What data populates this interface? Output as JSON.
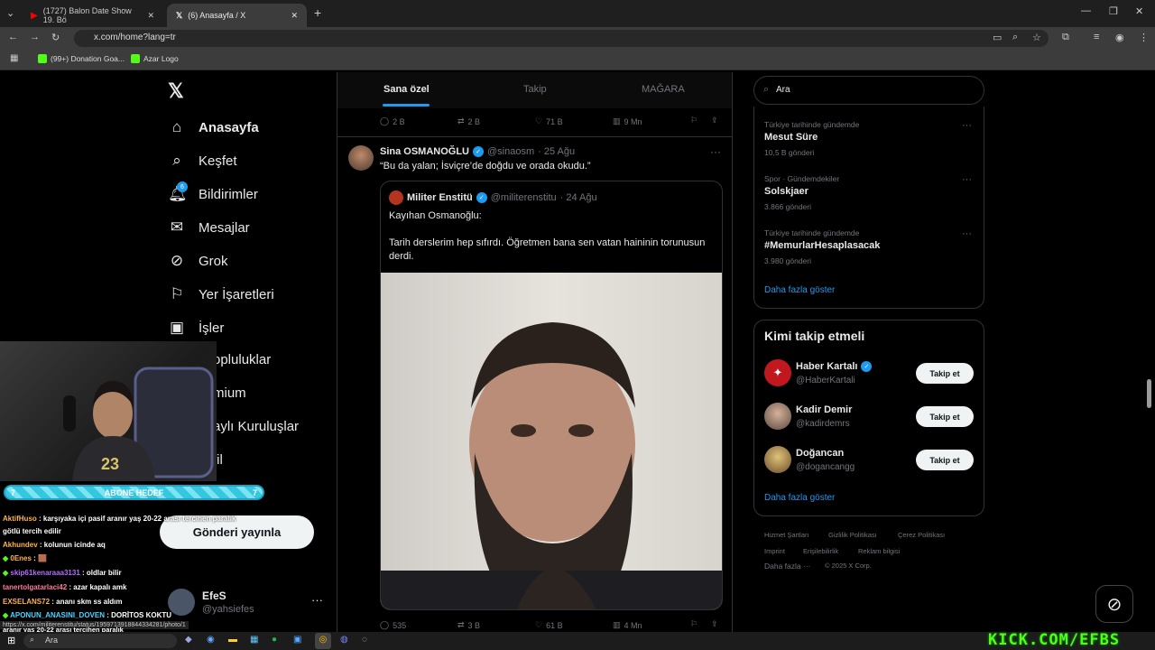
{
  "browser": {
    "tabs": [
      {
        "label": "(1727) Balon Date Show 19. Bö"
      },
      {
        "label": "(6) Anasayfa / X"
      }
    ],
    "url": "x.com/home?lang=tr",
    "bookmarks": [
      {
        "label": "(99+) Donation Goa..."
      },
      {
        "label": "Azar Logo"
      }
    ]
  },
  "nav": {
    "items": [
      {
        "label": "Anasayfa",
        "icon": "home-icon"
      },
      {
        "label": "Keşfet",
        "icon": "search-icon"
      },
      {
        "label": "Bildirimler",
        "icon": "bell-icon",
        "badge": "6"
      },
      {
        "label": "Mesajlar",
        "icon": "mail-icon"
      },
      {
        "label": "Grok",
        "icon": "grok-icon"
      },
      {
        "label": "Yer İşaretleri",
        "icon": "bookmark-icon"
      },
      {
        "label": "İşler",
        "icon": "briefcase-icon"
      },
      {
        "label": "opluluklar"
      },
      {
        "label": "mium"
      },
      {
        "label": "aylı Kuruluşlar"
      },
      {
        "label": "fil"
      }
    ],
    "post_button": "Gönderi yayınla",
    "account": {
      "name": "EfeS",
      "handle": "@yahsiefes"
    }
  },
  "feed": {
    "tabs": [
      "Sana özel",
      "Takip",
      "MAĞARA"
    ],
    "prev_actions": {
      "replies": "2 B",
      "reposts": "2 B",
      "likes": "71 B",
      "views": "9 Mn"
    },
    "post": {
      "author": "Sina OSMANOĞLU",
      "handle": "@sinaosm",
      "date": "· 25 Ağu",
      "text": "“Bu da yalan; İsviçre’de doğdu ve orada okudu.”",
      "quote": {
        "author": "Militer Enstitü",
        "handle": "@militerenstitu",
        "date": "· 24 Ağu",
        "line1": "Kayıhan Osmanoğlu:",
        "line2": "Tarih derslerim hep sıfırdı. Öğretmen bana sen vatan haininin torunusun derdi."
      },
      "actions": {
        "replies": "535",
        "reposts": "3 B",
        "likes": "61 B",
        "views": "4 Mn"
      }
    }
  },
  "sidebar": {
    "search_value": "Ara",
    "trends": [
      {
        "context": "Türkiye tarihinde gündemde",
        "topic": "Mesut Süre",
        "count": "10,5 B gönderi"
      },
      {
        "context": "Spor · Gündemdekiler",
        "topic": "Solskjaer",
        "count": "3.866 gönderi"
      },
      {
        "context": "Türkiye tarihinde gündemde",
        "topic": "#MemurlarHesaplasacak",
        "count": "3.980 gönderi"
      }
    ],
    "show_more": "Daha fazla göster",
    "who_to_follow": {
      "title": "Kimi takip etmeli",
      "users": [
        {
          "name": "Haber Kartalı",
          "handle": "@HaberKartali",
          "button": "Takip et"
        },
        {
          "name": "Kadir Demir",
          "handle": "@kadirdemrs",
          "button": "Takip et"
        },
        {
          "name": "Doğancan",
          "handle": "@dogancangg",
          "button": "Takip et"
        }
      ],
      "show_more": "Daha fazla göster"
    },
    "footer": [
      "Hizmet Şartları",
      "Gizlilik Politikası",
      "Çerez Politikası",
      "Imprint",
      "Erişilebilirlik",
      "Reklam bilgisi",
      "Daha fazla ···",
      "© 2025 X Corp."
    ]
  },
  "stream": {
    "goal_label": "ABONE HEDEF",
    "goal_left": "7",
    "goal_right": "7",
    "chat": [
      {
        "user": "AktifHuso",
        "text": " : karşıyaka içi pasif aranır yaş 20-22 arası tercihen paralık"
      },
      {
        "user": "",
        "text": "götlü tercih edilir"
      },
      {
        "user": "Akhundev",
        "text": " : kolunun icinde aq"
      },
      {
        "user": "0Enes",
        "text": " : 🟫"
      },
      {
        "user": "skip61kenaraaa3131",
        "text": " : oldlar bilir"
      },
      {
        "user": "tanertolgatarlaci42",
        "text": " : azar kapalı amk"
      },
      {
        "user": "EXSELANS72",
        "text": " : ananı skm ss aldım"
      },
      {
        "user": "APONUN_ANASINI_DOVEN",
        "text": " : DORİTOS KOKTU"
      }
    ],
    "status_url": "https://x.com/militerenstitu/status/1959713918844334281/photo/1",
    "status_tail": "aranır yaş 20-22 arası tercihen paralık",
    "watermark": "KICK.COM/EFBS"
  },
  "taskbar": {
    "search": "Ara"
  }
}
